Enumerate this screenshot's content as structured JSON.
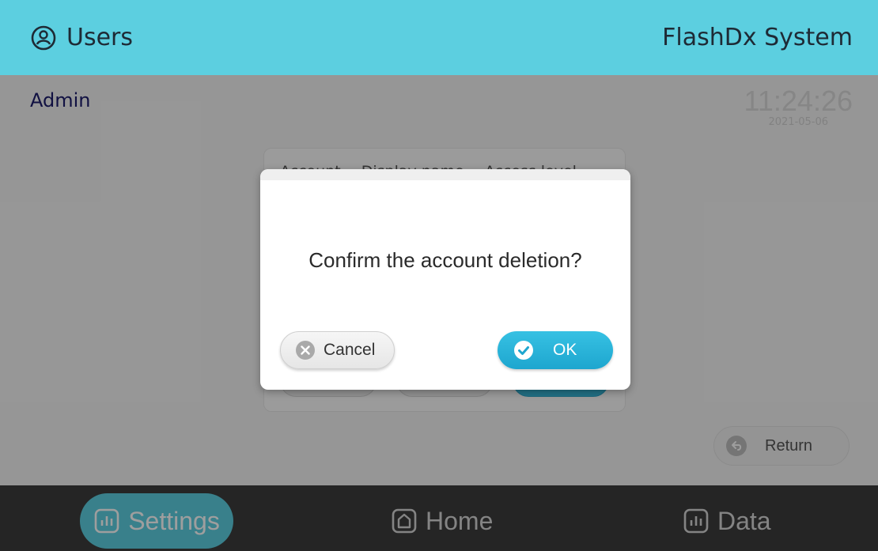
{
  "header": {
    "title": "Users",
    "system_name": "FlashDx System",
    "icon": "user-icon"
  },
  "main": {
    "user_role": "Admin",
    "clock_time": "11:24:26",
    "clock_date": "2021-05-06",
    "table_columns": [
      "Account",
      "Display name",
      "Access level"
    ],
    "return_label": "Return"
  },
  "dialog": {
    "message": "Confirm the account deletion?",
    "cancel_label": "Cancel",
    "ok_label": "OK"
  },
  "nav": {
    "settings_label": "Settings",
    "home_label": "Home",
    "data_label": "Data",
    "active": "Settings"
  },
  "colors": {
    "accent": "#5ccfe0",
    "nav_bg": "#3c3c3c",
    "ok_button": "#1ea6cf"
  }
}
